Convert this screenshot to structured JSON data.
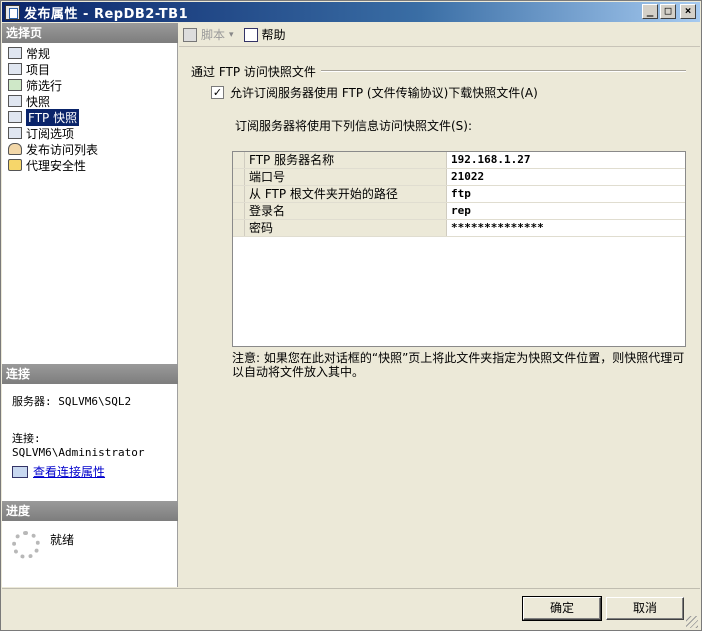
{
  "window": {
    "title": "发布属性 - RepDB2-TB1",
    "buttons": {
      "minimize": "_",
      "maximize": "□",
      "close": "×"
    }
  },
  "left": {
    "select_page_header": "选择页",
    "nav_items": [
      {
        "label": "常规",
        "icon": "general-page-icon"
      },
      {
        "label": "项目",
        "icon": "articles-page-icon"
      },
      {
        "label": "筛选行",
        "icon": "filter-rows-page-icon"
      },
      {
        "label": "快照",
        "icon": "snapshot-page-icon"
      },
      {
        "label": "FTP 快照",
        "icon": "ftp-snapshot-page-icon",
        "selected": true
      },
      {
        "label": "订阅选项",
        "icon": "subscription-options-page-icon"
      },
      {
        "label": "发布访问列表",
        "icon": "access-list-page-icon"
      },
      {
        "label": "代理安全性",
        "icon": "agent-security-page-icon"
      }
    ],
    "connection_header": "连接",
    "server_label": "服务器: SQLVM6\\SQL2",
    "connection_label": "连接: SQLVM6\\Administrator",
    "view_connection_link": "查看连接属性",
    "progress_header": "进度",
    "progress_status": "就绪"
  },
  "toolbar": {
    "script_label": "脚本",
    "script_arrow": "▾",
    "help_label": "帮助"
  },
  "main": {
    "group_title": "通过 FTP 访问快照文件",
    "checkbox_label": "允许订阅服务器使用 FTP (文件传输协议)下载快照文件(A)",
    "checkbox_checked": "✓",
    "subtitle": "订阅服务器将使用下列信息访问快照文件(S):",
    "grid_rows": [
      {
        "name": "FTP 服务器名称",
        "value": "192.168.1.27"
      },
      {
        "name": "端口号",
        "value": "21022"
      },
      {
        "name": "从 FTP 根文件夹开始的路径",
        "value": "ftp"
      },
      {
        "name": "登录名",
        "value": "rep"
      },
      {
        "name": "密码",
        "value": "**************"
      }
    ],
    "note": "注意: 如果您在此对话框的“快照”页上将此文件夹指定为快照文件位置，则快照代理可以自动将文件放入其中。"
  },
  "buttons": {
    "ok": "确定",
    "cancel": "取消"
  }
}
